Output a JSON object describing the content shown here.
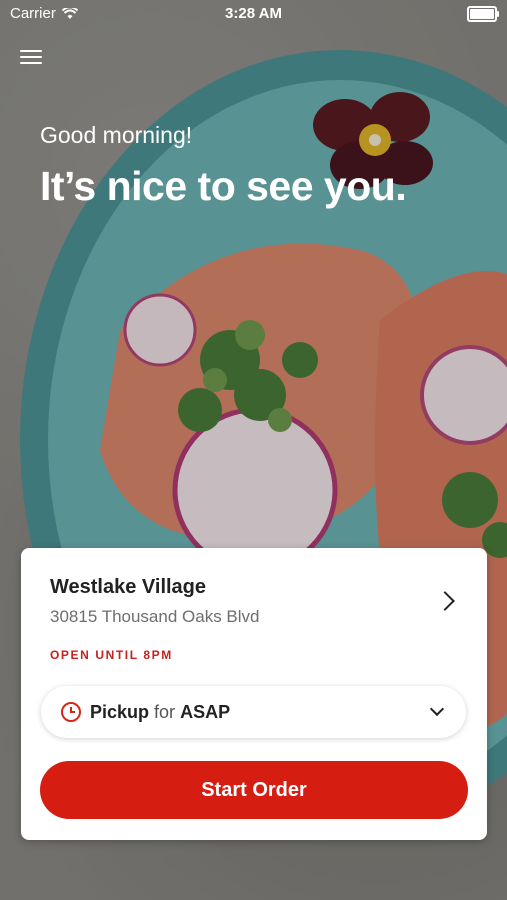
{
  "status_bar": {
    "carrier": "Carrier",
    "time": "3:28 AM"
  },
  "hero": {
    "greeting": "Good morning!",
    "headline": "It’s nice to see you."
  },
  "store": {
    "name": "Westlake Village",
    "address": "30815 Thousand Oaks Blvd",
    "hours_status": "OPEN UNTIL 8PM"
  },
  "order_mode": {
    "mode": "Pickup",
    "connector": "for",
    "time": "ASAP"
  },
  "cta": {
    "start_order": "Start Order"
  },
  "colors": {
    "accent": "#d51d12",
    "status_red": "#c4221e",
    "plate": "#5fa5a6"
  },
  "icons": [
    "wifi-icon",
    "battery-icon",
    "hamburger-menu-icon",
    "chevron-right-icon",
    "clock-icon",
    "chevron-down-icon"
  ]
}
